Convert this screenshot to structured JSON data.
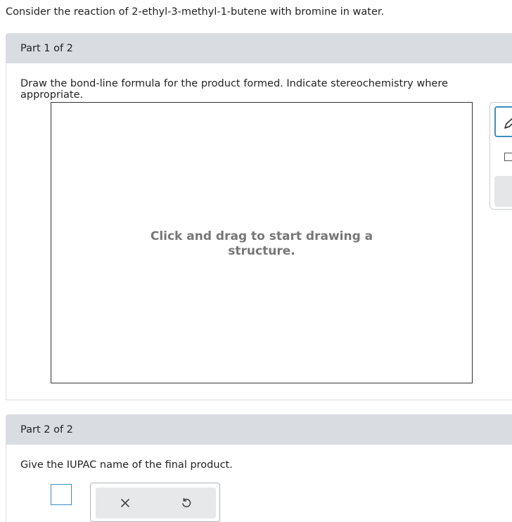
{
  "question": "Consider the reaction of 2-ethyl-3-methyl-1-butene with bromine in water.",
  "part1": {
    "header": "Part 1 of 2",
    "instruction": "Draw the bond-line formula for the product formed. Indicate stereochemistry where appropriate.",
    "canvas_hint": "Click and drag to start drawing a structure."
  },
  "part2": {
    "header": "Part 2 of 2",
    "instruction": "Give the IUPAC name of the final product.",
    "answer_value": ""
  },
  "toolbar": {
    "icons": [
      "pencil-icon",
      "square-icon",
      "blank-tool"
    ]
  },
  "actions": {
    "clear_icon": "close-icon",
    "reset_icon": "undo-icon"
  },
  "colors": {
    "header_bg": "#d9dde1",
    "accent": "#3b8fc4",
    "hint_text": "#777777"
  }
}
